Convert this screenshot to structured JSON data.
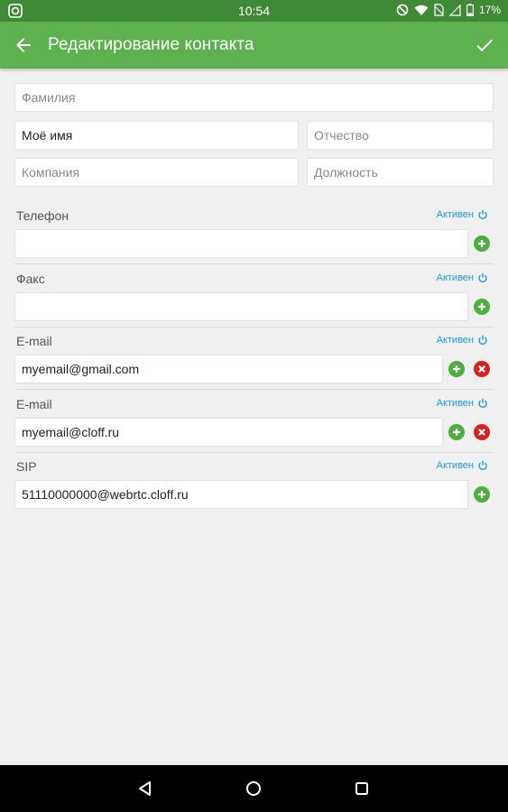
{
  "status_bar": {
    "time": "10:54",
    "battery": "17%",
    "icons": [
      "app-notification-icon",
      "do-not-disturb-icon",
      "wifi-icon",
      "no-sim-icon",
      "signal-icon",
      "battery-icon"
    ]
  },
  "app_bar": {
    "title": "Редактирование контакта",
    "back_icon": "arrow-back-icon",
    "done_icon": "checkmark-icon"
  },
  "name_fields": {
    "last_name": {
      "value": "",
      "placeholder": "Фамилия"
    },
    "first_name": {
      "value": "Моё имя",
      "placeholder": ""
    },
    "middle_name": {
      "value": "",
      "placeholder": "Отчество"
    },
    "company": {
      "value": "",
      "placeholder": "Компания"
    },
    "position": {
      "value": "",
      "placeholder": "Должность"
    }
  },
  "sections": [
    {
      "label": "Телефон",
      "status": "Активен",
      "value": "",
      "has_remove": false
    },
    {
      "label": "Факс",
      "status": "Активен",
      "value": "",
      "has_remove": false
    },
    {
      "label": "E-mail",
      "status": "Активен",
      "value": "myemail@gmail.com",
      "has_remove": true
    },
    {
      "label": "E-mail",
      "status": "Активен",
      "value": "myemail@cloff.ru",
      "has_remove": true
    },
    {
      "label": "SIP",
      "status": "Активен",
      "value": "51110000000@webrtc.cloff.ru",
      "has_remove": false
    }
  ],
  "colors": {
    "status_bar": "#3f8a37",
    "app_bar": "#5db14e",
    "accent_link": "#1e9ad6",
    "add_button": "#4caf3e",
    "remove_button": "#d7201f"
  },
  "nav_bar": {
    "icons": [
      "back-triangle-icon",
      "home-circle-icon",
      "recents-square-icon"
    ]
  }
}
